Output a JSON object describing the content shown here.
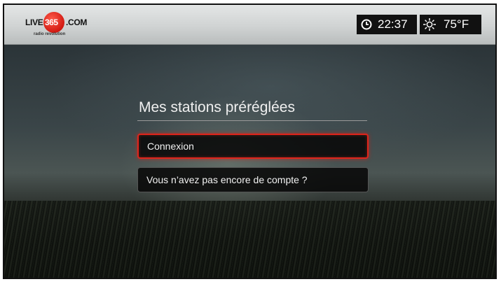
{
  "header": {
    "logo": {
      "live": "LIVE",
      "number": "365",
      "dotcom": ".COM",
      "tagline": "radio revolution"
    },
    "clock": {
      "icon": "clock-icon",
      "time": "22:37"
    },
    "weather": {
      "icon": "sun-icon",
      "temperature": "75°F"
    }
  },
  "main": {
    "title": "Mes stations préréglées",
    "buttons": [
      {
        "label": "Connexion",
        "focused": true
      },
      {
        "label": "Vous n’avez pas encore de compte ?",
        "focused": false
      }
    ]
  },
  "colors": {
    "focus_border": "#e0241b",
    "logo_red": "#d21a12",
    "pill_bg": "#111111"
  }
}
